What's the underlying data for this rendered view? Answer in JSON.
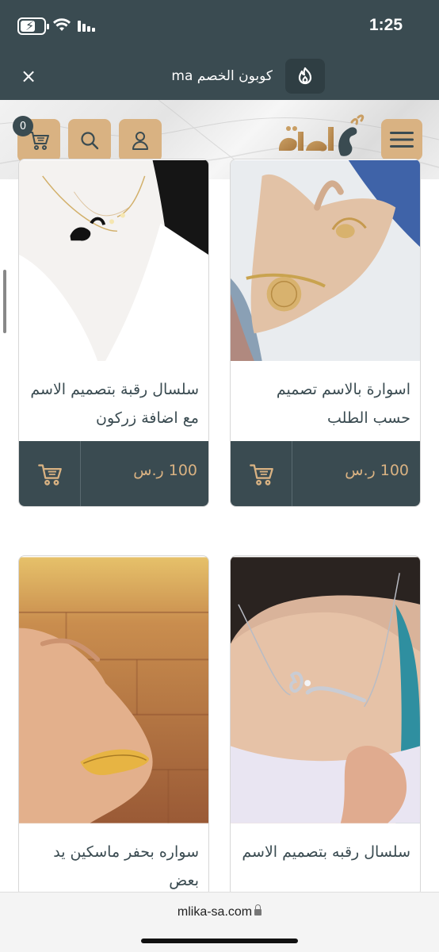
{
  "status_bar": {
    "time": "1:25",
    "battery_level": 0.55
  },
  "coupon_banner": {
    "text": "كوبون الخصم ma",
    "close_symbol": "×",
    "icon": "fire-icon"
  },
  "header": {
    "cart_count": "0",
    "brand_color": "#d9b282",
    "dark_color": "#3a4b51",
    "icons": [
      "cart-icon",
      "search-icon",
      "user-icon",
      "menu-icon"
    ]
  },
  "products": [
    {
      "title": "سلسال رقبة بتصميم الاسم مع اضافة زركون",
      "price": "100 ر.س"
    },
    {
      "title": "اسوارة بالاسم تصميم حسب الطلب",
      "price": "100 ر.س"
    },
    {
      "title": "سواره بحفر ماسكين يد بعض"
    },
    {
      "title": "سلسال رقبه بتصميم الاسم"
    }
  ],
  "browser": {
    "url": "mlika-sa.com"
  }
}
